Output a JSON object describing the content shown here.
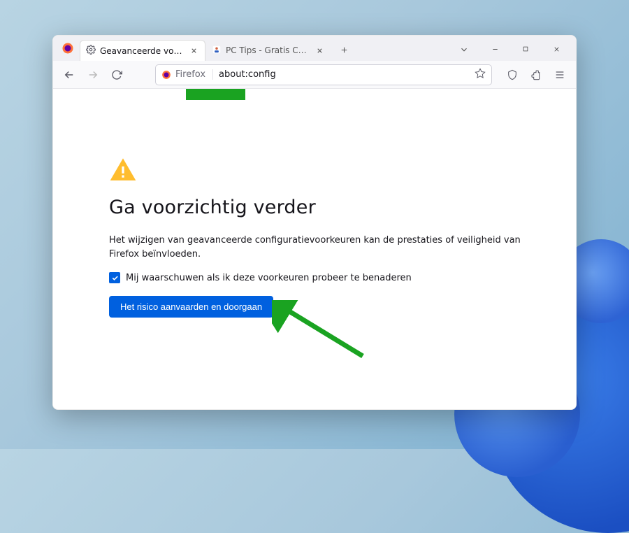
{
  "tabs": [
    {
      "label": "Geavanceerde voorkeuren",
      "active": true
    },
    {
      "label": "PC Tips - Gratis Computer Tips,",
      "active": false
    }
  ],
  "urlbar": {
    "identity": "Firefox",
    "address": "about:config"
  },
  "warning": {
    "title": "Ga voorzichtig verder",
    "body": "Het wijzigen van geavanceerde configuratievoorkeuren kan de prestaties of veiligheid van Firefox beïnvloeden.",
    "checkbox_label": "Mij waarschuwen als ik deze voorkeuren probeer te benaderen",
    "checkbox_checked": true,
    "button_label": "Het risico aanvaarden en doorgaan"
  },
  "colors": {
    "accent": "#0060df",
    "warn_icon": "#ffbd2e",
    "annotation": "#1aa321"
  }
}
